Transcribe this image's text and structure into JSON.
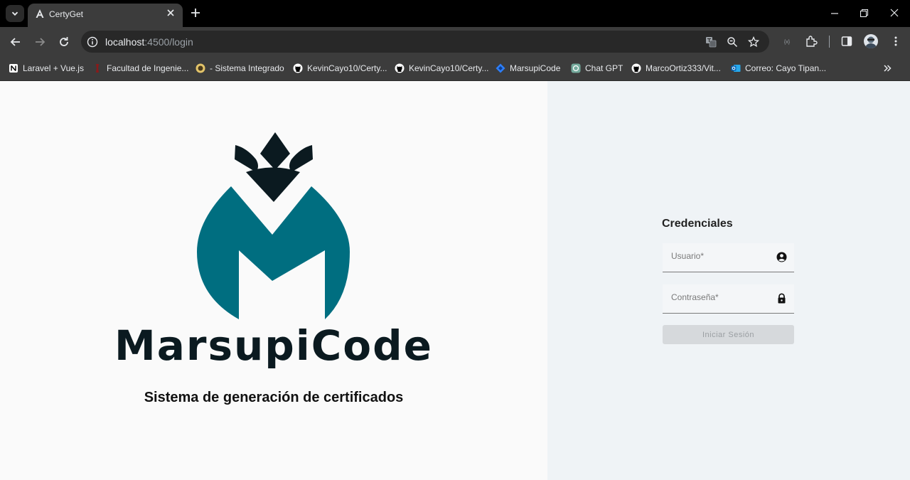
{
  "browser": {
    "tab": {
      "title": "CertyGet"
    },
    "url": {
      "host": "localhost",
      "rest": ":4500/login"
    },
    "bookmarks": [
      {
        "label": "Laravel + Vue.js",
        "icon": "notion-icon"
      },
      {
        "label": "Facultad de Ingenie...",
        "icon": "university-icon"
      },
      {
        "label": "- Sistema Integrado",
        "icon": "seal-icon"
      },
      {
        "label": "KevinCayo10/Certy...",
        "icon": "github-icon"
      },
      {
        "label": "KevinCayo10/Certy...",
        "icon": "github-icon"
      },
      {
        "label": "MarsupiCode",
        "icon": "diamond-icon"
      },
      {
        "label": "Chat GPT",
        "icon": "chatgpt-icon"
      },
      {
        "label": "MarcoOrtiz333/Vit...",
        "icon": "github-icon"
      },
      {
        "label": "Correo: Cayo Tipan...",
        "icon": "outlook-icon"
      }
    ]
  },
  "brand": {
    "logo_text": "MarsupiCode",
    "tagline": "Sistema de generación de certificados",
    "colors": {
      "teal": "#006e80",
      "dark": "#0b1a20"
    }
  },
  "login": {
    "title": "Credenciales",
    "username_placeholder": "Usuario*",
    "password_placeholder": "Contraseña*",
    "submit_label": "Iniciar Sesión"
  }
}
